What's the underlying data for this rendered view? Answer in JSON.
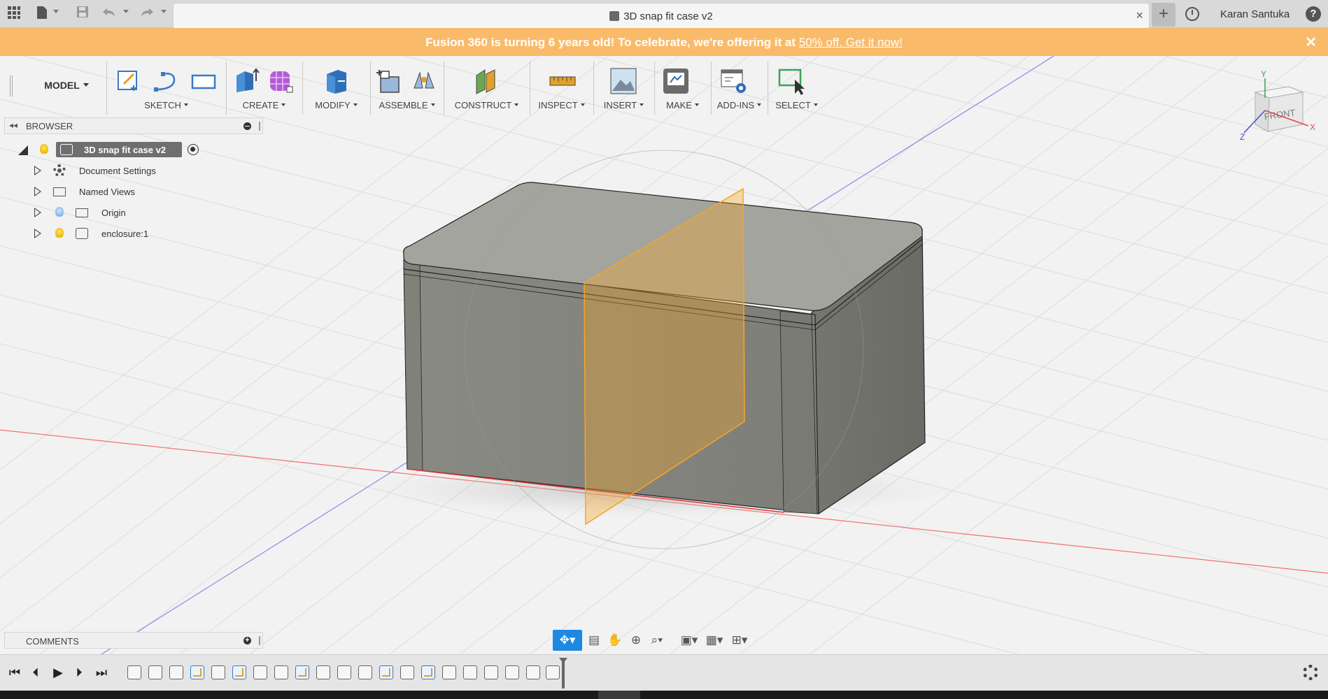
{
  "titlebar": {
    "doc_title": "3D snap fit case v2",
    "user_name": "Karan Santuka",
    "help_glyph": "?",
    "new_tab_glyph": "+",
    "close_glyph": "×"
  },
  "banner": {
    "message": "Fusion 360 is turning 6 years old! To celebrate, we're offering it at ",
    "link_text": "50% off. Get it now!",
    "close_glyph": "✕",
    "color": "#f9bb6a"
  },
  "toolbar": {
    "workspace": "MODEL",
    "groups": [
      {
        "label": "SKETCH"
      },
      {
        "label": "CREATE"
      },
      {
        "label": "MODIFY"
      },
      {
        "label": "ASSEMBLE"
      },
      {
        "label": "CONSTRUCT"
      },
      {
        "label": "INSPECT"
      },
      {
        "label": "INSERT"
      },
      {
        "label": "MAKE"
      },
      {
        "label": "ADD-INS"
      },
      {
        "label": "SELECT"
      }
    ]
  },
  "browser": {
    "title": "BROWSER",
    "root": "3D snap fit case v2",
    "items": [
      {
        "label": "Document Settings",
        "icon": "gear-icon"
      },
      {
        "label": "Named Views",
        "icon": "folder-icon"
      },
      {
        "label": "Origin",
        "icon": "folder-icon"
      },
      {
        "label": "enclosure:1",
        "icon": "component-icon"
      }
    ]
  },
  "viewcube": {
    "face": "FRONT",
    "axis_x": "X",
    "axis_y": "Y",
    "axis_z": "Z"
  },
  "comments": {
    "title": "COMMENTS"
  },
  "colors": {
    "accent": "#1e88e5",
    "plane": "#f5a623",
    "body": "#8a8a85"
  }
}
